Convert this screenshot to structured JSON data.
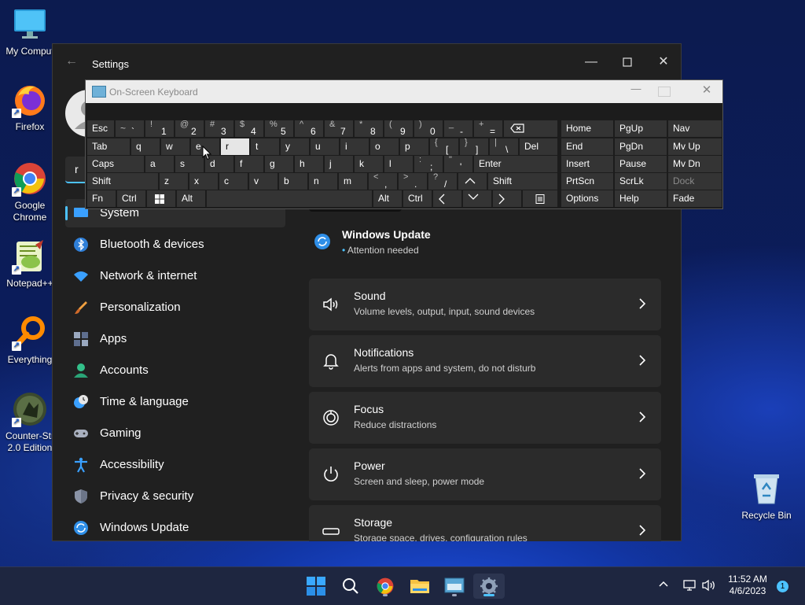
{
  "desktop": {
    "icons": [
      {
        "label_line1": "My Comput",
        "label_line2": "",
        "icon": "computer-icon"
      },
      {
        "label_line1": "Firefox",
        "label_line2": "",
        "icon": "firefox-icon"
      },
      {
        "label_line1": "Google",
        "label_line2": "Chrome",
        "icon": "chrome-icon"
      },
      {
        "label_line1": "Notepad++",
        "label_line2": "",
        "icon": "notepad-plus-plus-icon"
      },
      {
        "label_line1": "Everything",
        "label_line2": "",
        "icon": "everything-search-icon"
      },
      {
        "label_line1": "Counter-Str",
        "label_line2": "2.0 Edition",
        "icon": "counter-strike-icon"
      },
      {
        "label_line1": "Recycle Bin",
        "label_line2": "",
        "icon": "recycle-bin-icon"
      }
    ]
  },
  "settings": {
    "title": "Settings",
    "search_value": "r",
    "nav": [
      {
        "label": "System",
        "icon": "system-icon"
      },
      {
        "label": "Bluetooth & devices",
        "icon": "bluetooth-icon"
      },
      {
        "label": "Network & internet",
        "icon": "wifi-icon"
      },
      {
        "label": "Personalization",
        "icon": "brush-icon"
      },
      {
        "label": "Apps",
        "icon": "apps-icon"
      },
      {
        "label": "Accounts",
        "icon": "accounts-icon"
      },
      {
        "label": "Time & language",
        "icon": "clock-globe-icon"
      },
      {
        "label": "Gaming",
        "icon": "gamepad-icon"
      },
      {
        "label": "Accessibility",
        "icon": "accessibility-icon"
      },
      {
        "label": "Privacy & security",
        "icon": "shield-icon"
      },
      {
        "label": "Windows Update",
        "icon": "windows-update-icon"
      }
    ],
    "update_banner": {
      "title": "Windows Update",
      "status": "Attention needed"
    },
    "cards": [
      {
        "title": "Sound",
        "subtitle": "Volume levels, output, input, sound devices",
        "icon": "speaker-icon"
      },
      {
        "title": "Notifications",
        "subtitle": "Alerts from apps and system, do not disturb",
        "icon": "bell-icon"
      },
      {
        "title": "Focus",
        "subtitle": "Reduce distractions",
        "icon": "focus-icon"
      },
      {
        "title": "Power",
        "subtitle": "Screen and sleep, power mode",
        "icon": "power-icon"
      },
      {
        "title": "Storage",
        "subtitle": "Storage space, drives, configuration rules",
        "icon": "storage-icon"
      }
    ]
  },
  "osk": {
    "title": "On-Screen Keyboard",
    "row1": [
      "Esc",
      "~",
      "`",
      "!",
      "1",
      "@",
      "2",
      "#",
      "3",
      "$",
      "4",
      "%",
      "5",
      "^",
      "6",
      "&",
      "7",
      "*",
      "8",
      "(",
      "9",
      ")",
      "0",
      "_",
      "-",
      "+",
      "="
    ],
    "row2": [
      "Tab",
      "q",
      "w",
      "e",
      "r",
      "t",
      "y",
      "u",
      "i",
      "o",
      "p",
      "{",
      "[",
      "}",
      "]",
      "|",
      "\\",
      "Del"
    ],
    "row3": [
      "Caps",
      "a",
      "s",
      "d",
      "f",
      "g",
      "h",
      "j",
      "k",
      "l",
      ":",
      ";",
      "\"",
      "'",
      "Enter"
    ],
    "row4": [
      "Shift",
      "z",
      "x",
      "c",
      "v",
      "b",
      "n",
      "m",
      "<",
      ",",
      ">",
      ".",
      "?",
      "/",
      "Shift"
    ],
    "row5": [
      "Fn",
      "Ctrl",
      "Alt",
      "Alt",
      "Ctrl"
    ],
    "nav_keys": [
      [
        "Home",
        "PgUp",
        "Nav"
      ],
      [
        "End",
        "PgDn",
        "Mv Up"
      ],
      [
        "Insert",
        "Pause",
        "Mv Dn"
      ],
      [
        "PrtScn",
        "ScrLk",
        "Dock"
      ],
      [
        "Options",
        "Help",
        "Fade"
      ]
    ]
  },
  "taskbar": {
    "apps": [
      "start-icon",
      "search-icon",
      "chrome-icon",
      "file-explorer-icon",
      "osk-icon",
      "settings-icon"
    ],
    "time": "11:52 AM",
    "date": "4/6/2023",
    "notification_count": "1"
  }
}
